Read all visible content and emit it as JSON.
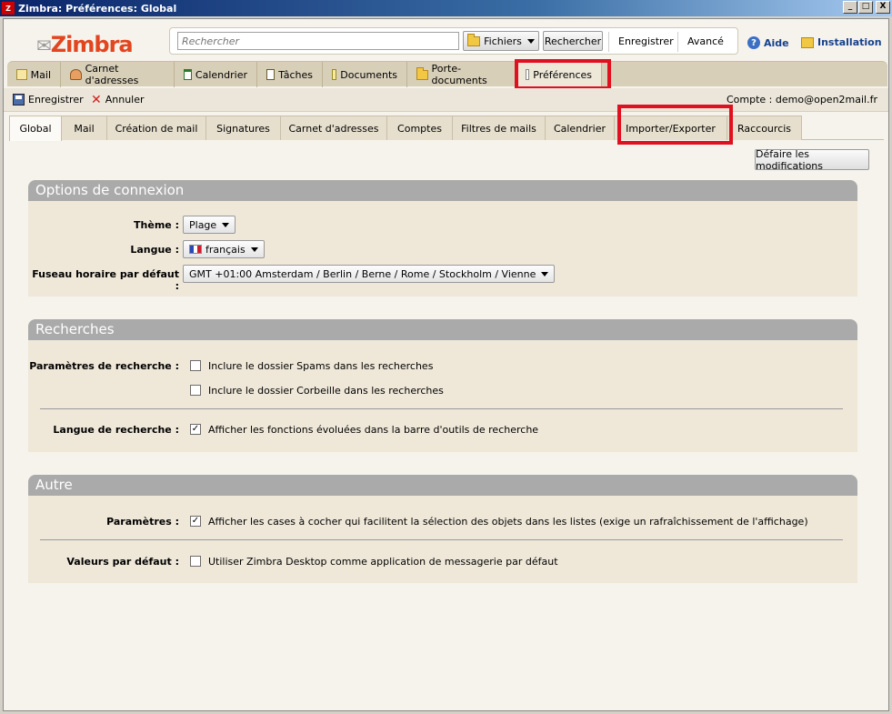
{
  "window": {
    "title": "Zimbra: Préférences: Global",
    "buttons": [
      "_",
      "□",
      "X"
    ]
  },
  "header": {
    "logo": "Zimbra",
    "search": {
      "placeholder": "Rechercher"
    },
    "files_label": "Fichiers",
    "search_button": "Rechercher",
    "save_link": "Enregistrer",
    "advanced_link": "Avancé",
    "help_label": "Aide",
    "install_label": "Installation"
  },
  "app_tabs": [
    {
      "label": "Mail",
      "icon": "mail-icon"
    },
    {
      "label": "Carnet d'adresses",
      "icon": "addressbook-icon"
    },
    {
      "label": "Calendrier",
      "icon": "calendar-icon"
    },
    {
      "label": "Tâches",
      "icon": "tasks-icon"
    },
    {
      "label": "Documents",
      "icon": "documents-icon"
    },
    {
      "label": "Porte-documents",
      "icon": "briefcase-icon"
    },
    {
      "label": "Préférences",
      "icon": "preferences-icon"
    }
  ],
  "toolbar": {
    "save_label": "Enregistrer",
    "cancel_label": "Annuler",
    "account": "Compte : demo@open2mail.fr"
  },
  "pref_tabs": [
    "Global",
    "Mail",
    "Création de mail",
    "Signatures",
    "Carnet d'adresses",
    "Comptes",
    "Filtres de mails",
    "Calendrier",
    "Importer/Exporter",
    "Raccourcis"
  ],
  "undo_button": "Défaire les modifications",
  "sections": {
    "login": {
      "title": "Options de connexion",
      "theme_label": "Thème :",
      "theme_value": "Plage",
      "language_label": "Langue :",
      "language_value": "français",
      "timezone_label": "Fuseau horaire par défaut :",
      "timezone_value": "GMT +01:00 Amsterdam / Berlin / Berne / Rome / Stockholm / Vienne"
    },
    "search": {
      "title": "Recherches",
      "params_label": "Paramètres de recherche :",
      "opt_spam": "Inclure le dossier Spams dans les recherches",
      "opt_spam_checked": false,
      "opt_trash": "Inclure le dossier Corbeille dans les recherches",
      "opt_trash_checked": false,
      "lang_label": "Langue de recherche :",
      "opt_advanced": "Afficher les fonctions évoluées dans la barre d'outils de recherche",
      "opt_advanced_checked": true
    },
    "other": {
      "title": "Autre",
      "params_label": "Paramètres :",
      "opt_checkboxes": "Afficher les cases à cocher qui facilitent la sélection des objets dans les listes (exige un rafraîchissement de l'affichage)",
      "opt_checkboxes_checked": true,
      "defaults_label": "Valeurs par défaut :",
      "opt_default_app": "Utiliser Zimbra Desktop comme application de messagerie par défaut",
      "opt_default_app_checked": false
    }
  },
  "colors": {
    "highlight": "#e01020",
    "section_header": "#aaaaaa",
    "link": "#15418c"
  }
}
